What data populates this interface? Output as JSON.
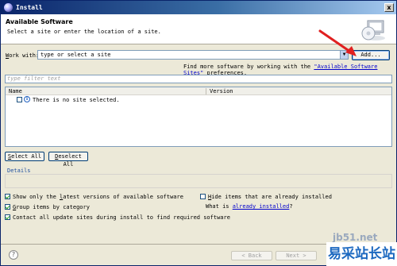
{
  "window": {
    "title": "Install",
    "close_glyph": "x"
  },
  "header": {
    "title": "Available Software",
    "description": "Select a site or enter the location of a site."
  },
  "work_with": {
    "label_accel": "W",
    "label_rest": "ork with:",
    "combo_value": "type or select a site",
    "add_label": "Add...",
    "find_more_prefix": "Find more software by working with the ",
    "find_more_link": "\"Available Software Sites\"",
    "find_more_suffix": " preferences."
  },
  "filter": {
    "placeholder": "type filter text"
  },
  "table": {
    "columns": [
      "Name",
      "Version"
    ],
    "rows": [
      {
        "name": "There is no site selected.",
        "checked": false
      }
    ]
  },
  "buttons": {
    "select_all_accel": "S",
    "select_all_rest": "elect All",
    "deselect_all_accel": "D",
    "deselect_all_rest": "eselect All"
  },
  "details": {
    "label": "Details"
  },
  "options": {
    "latest": {
      "before": "Show only the ",
      "accel": "l",
      "after": "atest versions of available software",
      "checked": true
    },
    "group": {
      "accel": "G",
      "after": "roup items by category",
      "checked": true
    },
    "contact": {
      "text": "Contact all update sites during install to find required software",
      "checked": true
    },
    "hide": {
      "accel": "H",
      "after": "ide items that are already installed",
      "checked": false
    },
    "what_is_prefix": "What is ",
    "what_is_link": "already installed",
    "what_is_suffix": "?"
  },
  "footer": {
    "back_label": "< Back",
    "next_label": "Next >",
    "help_glyph": "?"
  },
  "watermark": {
    "url": "jb51.net",
    "brand": "易采站长站"
  }
}
